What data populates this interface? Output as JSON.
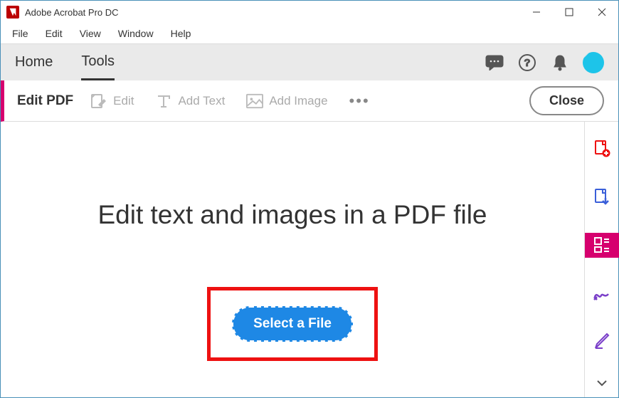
{
  "window": {
    "title": "Adobe Acrobat Pro DC"
  },
  "menubar": {
    "items": [
      "File",
      "Edit",
      "View",
      "Window",
      "Help"
    ]
  },
  "navbar": {
    "tabs": [
      {
        "label": "Home",
        "active": false
      },
      {
        "label": "Tools",
        "active": true
      }
    ]
  },
  "toolbar": {
    "title": "Edit PDF",
    "edit_label": "Edit",
    "add_text_label": "Add Text",
    "add_image_label": "Add Image",
    "more_label": "•••",
    "close_label": "Close"
  },
  "main": {
    "headline": "Edit text and images in a PDF file",
    "select_button": "Select a File"
  },
  "sidebar": {
    "items": [
      {
        "name": "create-pdf",
        "color": "#e11",
        "active": false
      },
      {
        "name": "export-pdf",
        "color": "#3a5fd9",
        "active": false
      },
      {
        "name": "edit-pdf",
        "color": "#fff",
        "active": true
      },
      {
        "name": "sign",
        "color": "#7a3fc9",
        "active": false
      },
      {
        "name": "comment",
        "color": "#7a3fc9",
        "active": false
      }
    ]
  }
}
